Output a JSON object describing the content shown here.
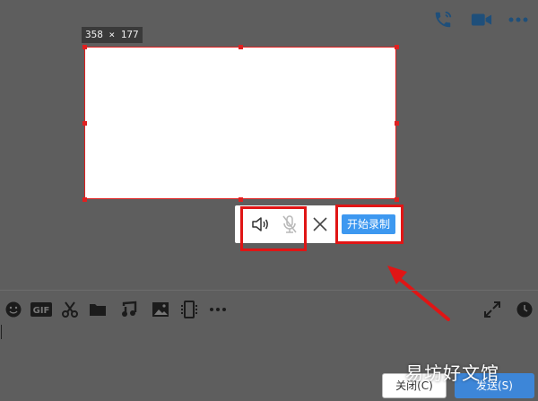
{
  "header": {
    "icons": [
      "phone-icon",
      "video-camera-icon",
      "more-icon"
    ]
  },
  "capture": {
    "size_readout": "358 × 177"
  },
  "recorder": {
    "start_label": "开始录制",
    "icons": [
      "speaker-icon",
      "microphone-muted-icon",
      "close-icon"
    ]
  },
  "input_toolbar": {
    "icons": [
      "emoji-icon",
      "gif-icon",
      "scissors-icon",
      "folder-icon",
      "music-note-icon",
      "image-icon",
      "screen-record-icon",
      "more-icon",
      "expand-icon",
      "history-clock-icon"
    ]
  },
  "footer": {
    "close_label": "关闭(C)",
    "send_label": "发送(S)"
  },
  "watermark": {
    "text": "易坊好文馆"
  },
  "colors": {
    "background": "#5e5e5e",
    "highlight_red": "#e01515",
    "accent_blue": "#3d98f0"
  }
}
